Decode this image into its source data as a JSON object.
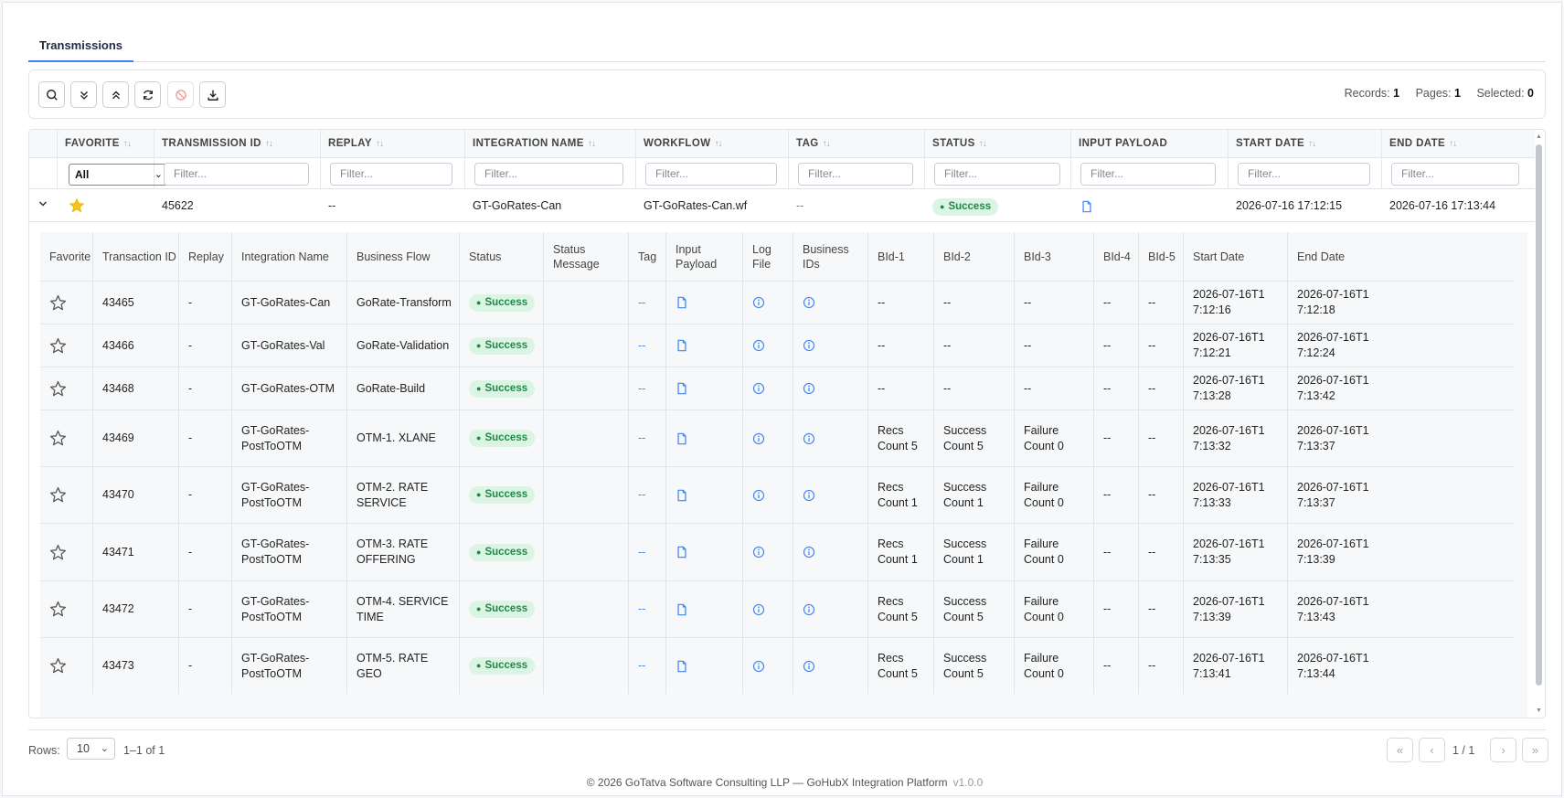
{
  "tabs": [
    {
      "label": "Transmissions"
    }
  ],
  "toolbar": {
    "records_label": "Records:",
    "records": "1",
    "pages_label": "Pages:",
    "pages": "1",
    "selected_label": "Selected:",
    "selected": "0"
  },
  "grid": {
    "columns": [
      "FAVORITE",
      "TRANSMISSION ID",
      "REPLAY",
      "INTEGRATION NAME",
      "WORKFLOW",
      "TAG",
      "STATUS",
      "INPUT PAYLOAD",
      "START DATE",
      "END DATE"
    ],
    "favorite_filter": "All",
    "filter_placeholder": "Filter...",
    "row": {
      "transmission_id": "45622",
      "replay": "--",
      "integration_name": "GT-GoRates-Can",
      "workflow": "GT-GoRates-Can.wf",
      "tag": "--",
      "status": "Success",
      "start_date": "2026-07-16 17:12:15",
      "end_date": "2026-07-16 17:13:44"
    }
  },
  "detail": {
    "headers": [
      "Favorite",
      "Transaction ID",
      "Replay",
      "Integration Name",
      "Business Flow",
      "Status",
      "Status Message",
      "Tag",
      "Input Payload",
      "Log File",
      "Business IDs",
      "BId-1",
      "BId-2",
      "BId-3",
      "BId-4",
      "BId-5",
      "Start Date",
      "End Date"
    ],
    "rows": [
      {
        "id": "43465",
        "replay": "-",
        "name": "GT-GoRates-Can",
        "flow": "GoRate-Transform",
        "status": "Success",
        "tag": "--",
        "b1": "--",
        "b2": "--",
        "b3": "--",
        "b4": "--",
        "b5": "--",
        "start": "2026-07-16T17:12:16",
        "end": "2026-07-16T17:12:18"
      },
      {
        "id": "43466",
        "replay": "-",
        "name": "GT-GoRates-Val",
        "flow": "GoRate-Validation",
        "status": "Success",
        "tag": "--",
        "b1": "--",
        "b2": "--",
        "b3": "--",
        "b4": "--",
        "b5": "--",
        "start": "2026-07-16T17:12:21",
        "end": "2026-07-16T17:12:24"
      },
      {
        "id": "43468",
        "replay": "-",
        "name": "GT-GoRates-OTM",
        "flow": "GoRate-Build",
        "status": "Success",
        "tag": "--",
        "b1": "--",
        "b2": "--",
        "b3": "--",
        "b4": "--",
        "b5": "--",
        "start": "2026-07-16T17:13:28",
        "end": "2026-07-16T17:13:42"
      },
      {
        "id": "43469",
        "replay": "-",
        "name": "GT-GoRates-PostToOTM",
        "flow": "OTM-1. XLANE",
        "status": "Success",
        "tag": "--",
        "b1": "Recs Count 5",
        "b2": "Success Count 5",
        "b3": "Failure Count 0",
        "b4": "--",
        "b5": "--",
        "start": "2026-07-16T17:13:32",
        "end": "2026-07-16T17:13:37"
      },
      {
        "id": "43470",
        "replay": "-",
        "name": "GT-GoRates-PostToOTM",
        "flow": "OTM-2. RATE SERVICE",
        "status": "Success",
        "tag": "--",
        "b1": "Recs Count 1",
        "b2": "Success Count 1",
        "b3": "Failure Count 0",
        "b4": "--",
        "b5": "--",
        "start": "2026-07-16T17:13:33",
        "end": "2026-07-16T17:13:37"
      },
      {
        "id": "43471",
        "replay": "-",
        "name": "GT-GoRates-PostToOTM",
        "flow": "OTM-3. RATE OFFERING",
        "status": "Success",
        "tag": "--",
        "b1": "Recs Count 1",
        "b2": "Success Count 1",
        "b3": "Failure Count 0",
        "b4": "--",
        "b5": "--",
        "start": "2026-07-16T17:13:35",
        "end": "2026-07-16T17:13:39"
      },
      {
        "id": "43472",
        "replay": "-",
        "name": "GT-GoRates-PostToOTM",
        "flow": "OTM-4. SERVICE TIME",
        "status": "Success",
        "tag": "--",
        "b1": "Recs Count 5",
        "b2": "Success Count 5",
        "b3": "Failure Count 0",
        "b4": "--",
        "b5": "--",
        "start": "2026-07-16T17:13:39",
        "end": "2026-07-16T17:13:43"
      },
      {
        "id": "43473",
        "replay": "-",
        "name": "GT-GoRates-PostToOTM",
        "flow": "OTM-5. RATE GEO",
        "status": "Success",
        "tag": "--",
        "b1": "Recs Count 5",
        "b2": "Success Count 5",
        "b3": "Failure Count 0",
        "b4": "--",
        "b5": "--",
        "start": "2026-07-16T17:13:41",
        "end": "2026-07-16T17:13:44"
      }
    ]
  },
  "pager": {
    "rows_label": "Rows:",
    "rows_value": "10",
    "range": "1–1 of 1",
    "page_info": "1 / 1"
  },
  "footer": {
    "text": "© 2026 GoTatva Software Consulting LLP — GoHubX Integration Platform",
    "version": "v1.0.0"
  },
  "colors": {
    "accent": "#3b82f6",
    "success_bg": "#dcf4e4",
    "success_text": "#1e8a45",
    "star": "#f5c518"
  }
}
